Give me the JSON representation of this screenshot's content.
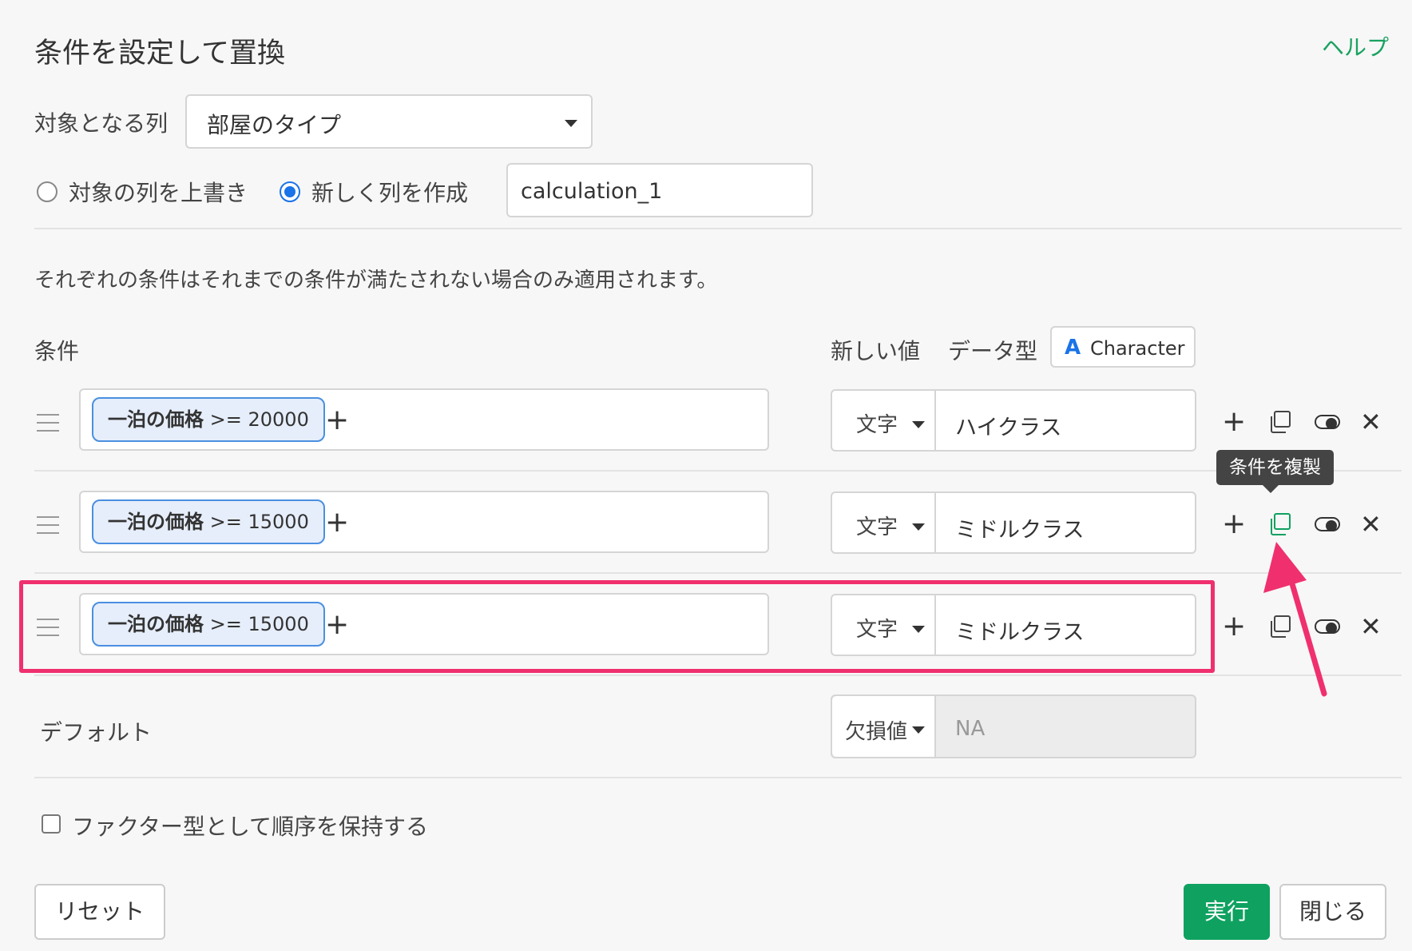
{
  "dialog": {
    "title": "条件を設定して置換",
    "help": "ヘルプ"
  },
  "target": {
    "label": "対象となる列",
    "selected": "部屋のタイプ"
  },
  "mode": {
    "overwrite_label": "対象の列を上書き",
    "new_column_label": "新しく列を作成",
    "selected": "new_column",
    "new_column_name": "calculation_1"
  },
  "note": "それぞれの条件はそれまでの条件が満たされない場合のみ適用されます。",
  "headers": {
    "condition": "条件",
    "new_value": "新しい値",
    "data_type": "データ型",
    "type_icon": "A",
    "type_value": "Character"
  },
  "rows": [
    {
      "field": "一泊の価格",
      "op": ">= 20000",
      "value_type": "文字",
      "value": "ハイクラス"
    },
    {
      "field": "一泊の価格",
      "op": ">= 15000",
      "value_type": "文字",
      "value": "ミドルクラス"
    },
    {
      "field": "一泊の価格",
      "op": ">= 15000",
      "value_type": "文字",
      "value": "ミドルクラス"
    }
  ],
  "tooltip": "条件を複製",
  "default": {
    "label": "デフォルト",
    "type": "欠損値",
    "value": "NA"
  },
  "factor_checkbox": {
    "label": "ファクター型として順序を保持する",
    "checked": false
  },
  "buttons": {
    "reset": "リセット",
    "run": "実行",
    "close": "閉じる"
  },
  "colors": {
    "accent_green": "#0fa160",
    "highlight_pink": "#f0306e",
    "pill_blue": "#4a8fe0"
  }
}
